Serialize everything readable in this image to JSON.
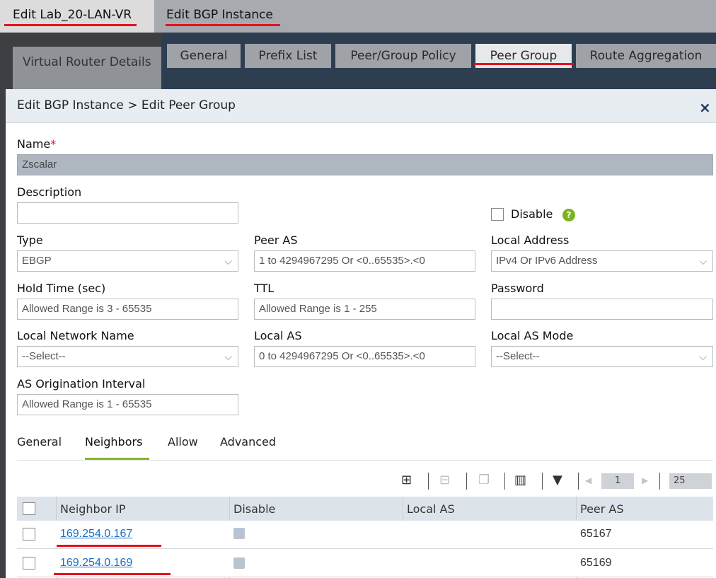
{
  "window_tabs": {
    "vr_title": "Edit Lab_20-LAN-VR",
    "bgp_title": "Edit BGP Instance"
  },
  "vr_details_label": "Virtual Router Details",
  "bgp_tabs": [
    "General",
    "Prefix List",
    "Peer/Group Policy",
    "Peer Group",
    "Route Aggregation"
  ],
  "modal": {
    "title": "Edit BGP Instance > Edit Peer Group",
    "close": "×"
  },
  "form": {
    "name_label": "Name",
    "name_required": "*",
    "name_value": "Zscalar",
    "description_label": "Description",
    "description_value": "",
    "disable_label": "Disable",
    "help_glyph": "?",
    "type_label": "Type",
    "type_value": "EBGP",
    "peer_as_label": "Peer AS",
    "peer_as_placeholder": "1 to 4294967295 Or <0..65535>.<0",
    "local_address_label": "Local Address",
    "local_address_value": "IPv4 Or IPv6 Address",
    "hold_time_label": "Hold Time (sec)",
    "hold_time_placeholder": "Allowed Range is 3 - 65535",
    "ttl_label": "TTL",
    "ttl_placeholder": "Allowed Range is 1 - 255",
    "password_label": "Password",
    "password_value": "",
    "local_network_label": "Local Network Name",
    "local_network_value": "--Select--",
    "local_as_label": "Local AS",
    "local_as_placeholder": "0 to 4294967295 Or <0..65535>.<0",
    "local_as_mode_label": "Local AS Mode",
    "local_as_mode_value": "--Select--",
    "as_orig_label": "AS Origination Interval",
    "as_orig_placeholder": "Allowed Range is 1 - 65535"
  },
  "subtabs": [
    "General",
    "Neighbors",
    "Allow",
    "Advanced"
  ],
  "pager": {
    "page": "1",
    "page_size": "25"
  },
  "table": {
    "headers": [
      "Neighbor IP",
      "Disable",
      "Local AS",
      "Peer AS"
    ],
    "rows": [
      {
        "neighbor_ip": "169.254.0.167",
        "local_as": "",
        "peer_as": "65167"
      },
      {
        "neighbor_ip": "169.254.0.169",
        "local_as": "",
        "peer_as": "65169"
      }
    ]
  }
}
